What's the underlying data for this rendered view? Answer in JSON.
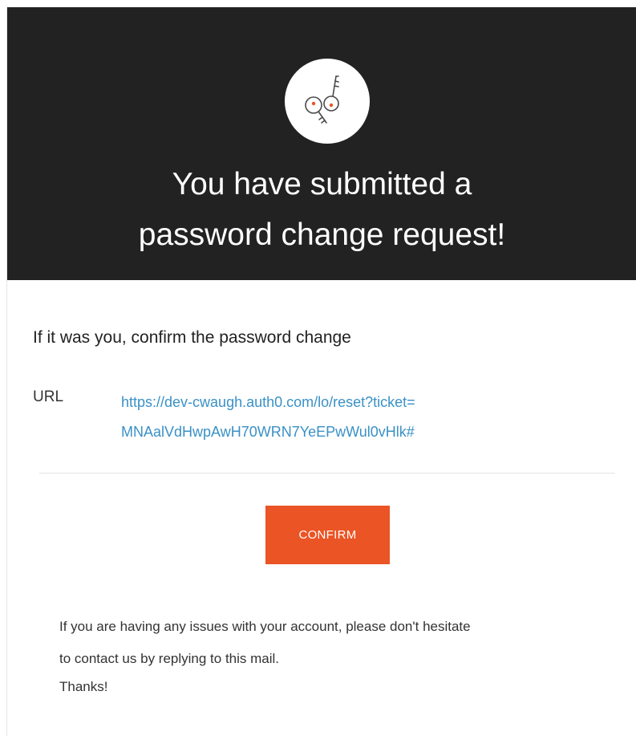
{
  "hero": {
    "icon": "keys-icon",
    "title_line1": "You have submitted a",
    "title_line2": "password change request!",
    "background_color": "#222222"
  },
  "body": {
    "intro": "If it was you, confirm the password change",
    "url_label": "URL",
    "url_line1": "https://dev-cwaugh.auth0.com/lo/reset?ticket=",
    "url_line2": "MNAalVdHwpAwH70WRN7YeEPwWul0vHlk#",
    "link_color": "#3a91c6"
  },
  "confirm": {
    "label": "CONFIRM",
    "color": "#eb5424"
  },
  "footer": {
    "line1": "If you are having any issues with your account, please don't hesitate",
    "line2": "to contact us by replying to this mail.",
    "thanks": "Thanks!"
  }
}
